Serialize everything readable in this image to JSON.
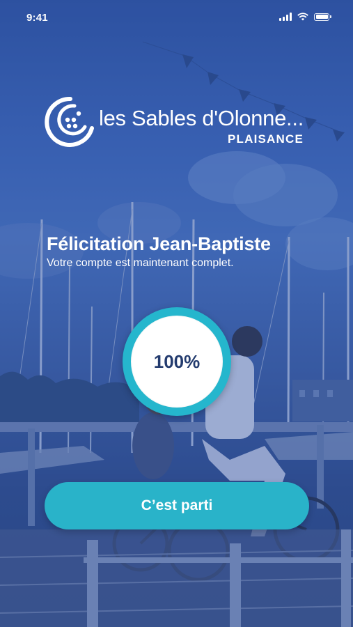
{
  "status_bar": {
    "time": "9:41"
  },
  "logo": {
    "name": "les Sables d'Olonne...",
    "tagline": "PLAISANCE"
  },
  "welcome": {
    "title": "Félicitation Jean-Baptiste",
    "subtitle": "Votre compte est maintenant complet."
  },
  "profile_progress": {
    "percent": 1.0,
    "label": "100%"
  },
  "cta": {
    "label": "C’est parti"
  },
  "colors": {
    "accent": "#29b3c9",
    "progress_text": "#233b6e",
    "overlay": "#3d64b5",
    "text": "#ffffff"
  }
}
